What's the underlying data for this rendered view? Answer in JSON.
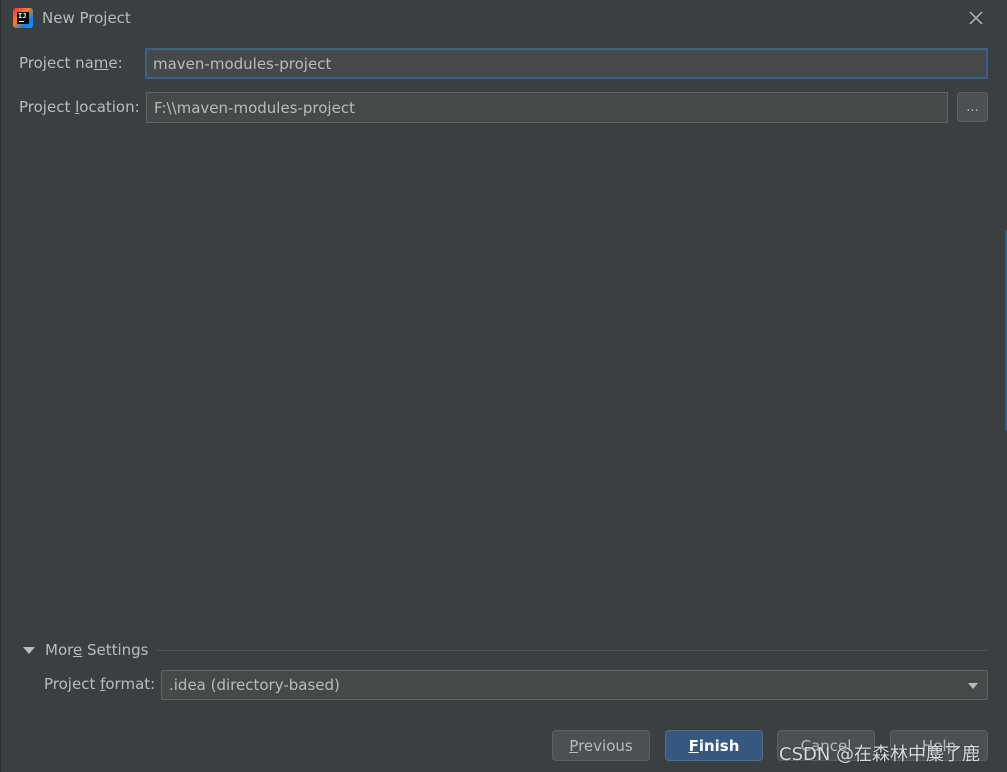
{
  "window": {
    "title": "New Project",
    "logo_text": "IJ"
  },
  "form": {
    "project_name": {
      "label_pre": "Project na",
      "label_mnemonic": "m",
      "label_post": "e:",
      "value": "maven-modules-project"
    },
    "project_location": {
      "label_pre": "Project ",
      "label_mnemonic": "l",
      "label_post": "ocation:",
      "value": "F:\\\\maven-modules-project",
      "browse_label": "..."
    }
  },
  "more_settings": {
    "label_pre": "Mor",
    "label_mnemonic": "e",
    "label_post": " Settings",
    "expanded": true,
    "project_format": {
      "label_pre": "Project ",
      "label_mnemonic": "f",
      "label_post": "ormat:",
      "value": ".idea (directory-based)"
    }
  },
  "buttons": {
    "previous": {
      "mnemonic": "P",
      "rest": "revious"
    },
    "finish": {
      "mnemonic": "F",
      "rest": "inish"
    },
    "cancel": {
      "label": "Cancel"
    },
    "help": {
      "label": "Help"
    }
  },
  "watermark": "CSDN @在森林中麋了鹿",
  "colors": {
    "background": "#3c3f41",
    "field_bg": "#45494a",
    "focus_border": "#3d6185",
    "primary_button": "#365880",
    "text": "#bbbbbb"
  }
}
